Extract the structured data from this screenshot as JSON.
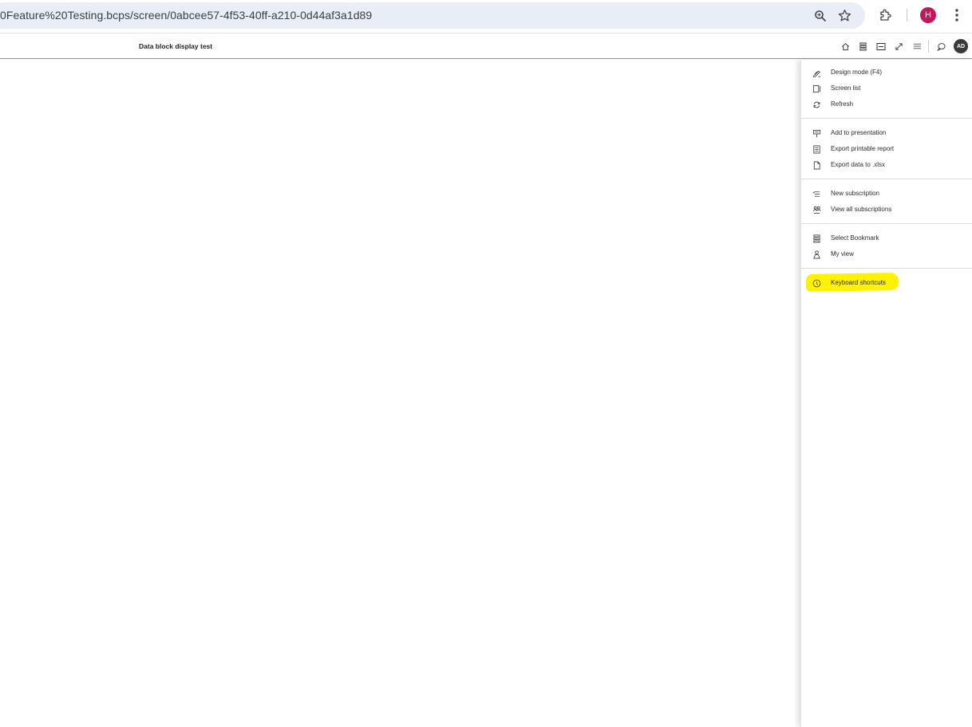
{
  "browser": {
    "url": "0Feature%20Testing.bcps/screen/0abcee57-4f53-40ff-a210-0d44af3a1d89",
    "profile_initial": "H",
    "icons": [
      "zoom-icon",
      "bookmark-star-icon",
      "extensions-icon",
      "browser-menu-icon"
    ]
  },
  "app_header": {
    "title": "Data block display test",
    "icons": [
      "home-icon",
      "screen-list-icon",
      "fit-width-icon",
      "fullscreen-icon",
      "hamburger-menu-icon",
      "comment-icon"
    ],
    "user_initials": "AD"
  },
  "side_menu": {
    "groups": [
      {
        "items": [
          {
            "label": "Design mode (F4)",
            "icon": "design-mode-icon"
          },
          {
            "label": "Screen list",
            "icon": "screen-list-icon"
          },
          {
            "label": "Refresh",
            "icon": "refresh-icon"
          }
        ]
      },
      {
        "items": [
          {
            "label": "Add to presentation",
            "icon": "presentation-icon"
          },
          {
            "label": "Export printable report",
            "icon": "printable-report-icon"
          },
          {
            "label": "Export data to .xlsx",
            "icon": "file-icon"
          }
        ]
      },
      {
        "items": [
          {
            "label": "New subscription",
            "icon": "new-subscription-icon"
          },
          {
            "label": "View all subscriptions",
            "icon": "subscriptions-icon"
          }
        ]
      },
      {
        "items": [
          {
            "label": "Select Bookmark",
            "icon": "bookmark-icon"
          },
          {
            "label": "My view",
            "icon": "my-view-icon"
          }
        ]
      },
      {
        "items": [
          {
            "label": "Keyboard shortcuts",
            "icon": "keyboard-shortcuts-icon",
            "highlighted": true
          }
        ]
      }
    ],
    "highlight_color": "#fff200"
  },
  "colors": {
    "header_accent": "#38b4c0",
    "profile_avatar": "#c2185b",
    "user_avatar": "#3a3a3a"
  }
}
